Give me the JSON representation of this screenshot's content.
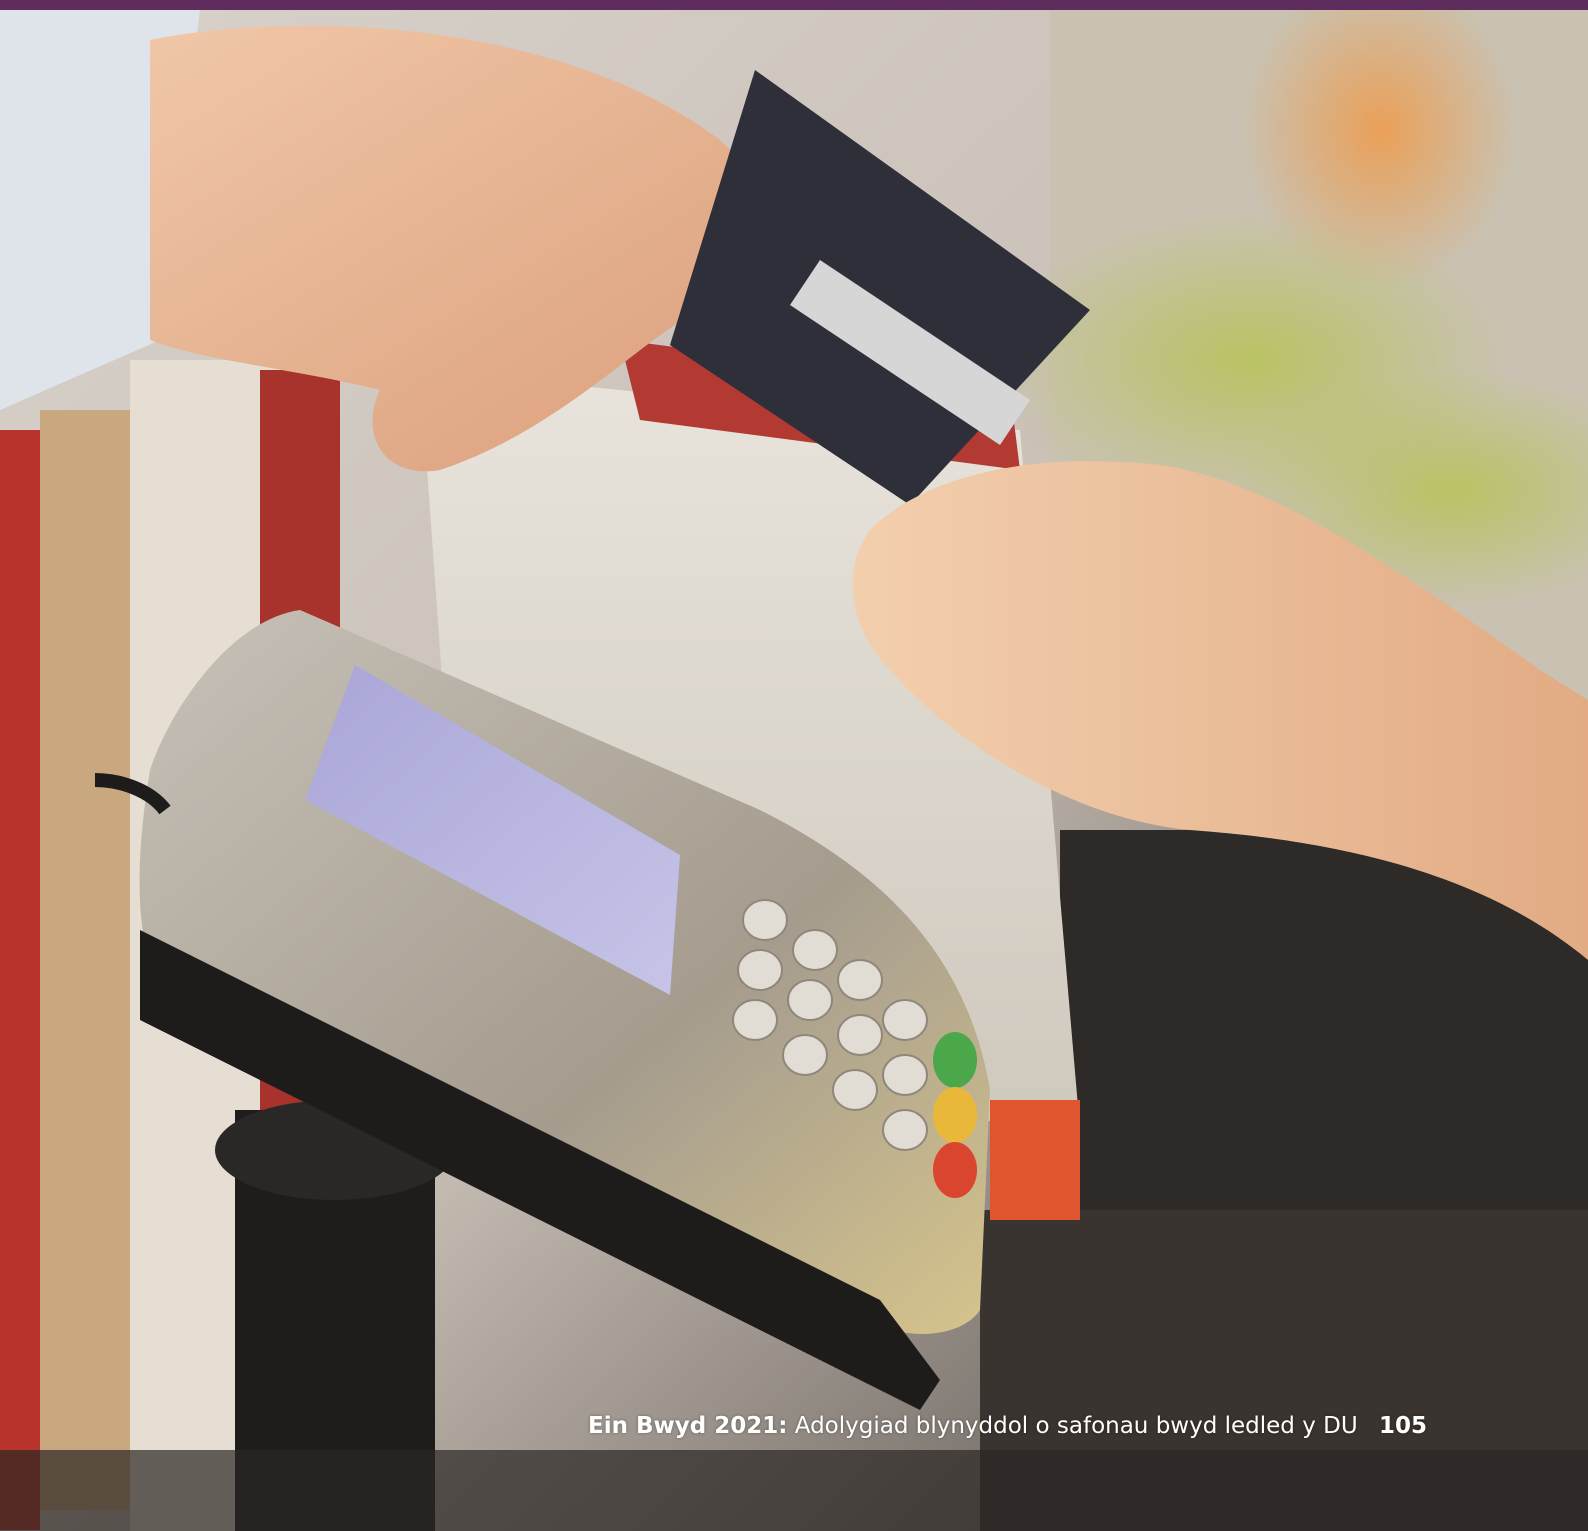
{
  "footer": {
    "report_title": "Ein Bwyd 2021:",
    "report_subtitle": "Adolygiad blynyddol o safonau bwyd ledled y DU",
    "page_number": "105"
  },
  "colors": {
    "brand_bar": "#5e2d5e"
  }
}
